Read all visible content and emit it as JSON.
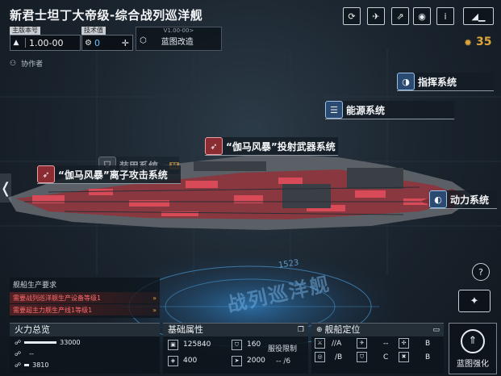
{
  "header": {
    "title": "新君士坦丁大帝级-综合战列巡洋舰",
    "icons": [
      "refresh-icon",
      "share-icon",
      "export-icon",
      "view-icon",
      "info-icon",
      "back-icon"
    ],
    "info_label": "i",
    "currency_value": "35"
  },
  "version_bar": {
    "main_version_label": "主版本号",
    "main_version_value": "1.00-00",
    "tech_label": "技术值",
    "tech_value": "0",
    "version_small": "V1.00-00>",
    "blueprint_mod": "蓝图改造"
  },
  "collaborator": "协作者",
  "systems": {
    "command": "指挥系统",
    "energy": "能源系统",
    "weapon": "“伽马风暴”投射武器系统",
    "armor": "装甲系统",
    "ion": "“伽马风暴”离子攻击系统",
    "power": "动力系统"
  },
  "armor_badge": "M",
  "hull_number": "1523",
  "hull_text": "战列巡洋舰",
  "production": {
    "title": "舰船生产要求",
    "req1": "需要战列巡洋舰生产设备等级1",
    "req2": "需要超主力舰生产线1等级1"
  },
  "firepower": {
    "title": "火力总览",
    "row1": "33000",
    "row2": "--",
    "row3": "3810"
  },
  "base_attrs": {
    "title": "基础属性",
    "hp": "125840",
    "armor": "160",
    "shield": "400",
    "speed": "2000",
    "service_limit_label": "服役限制",
    "service_limit_value": "-- /6"
  },
  "positioning": {
    "title": "舰船定位",
    "cells": [
      {
        "left": "//",
        "right": "A"
      },
      {
        "left": "",
        "right": "--"
      },
      {
        "left": "",
        "right": "B"
      },
      {
        "left": "/",
        "right": "B"
      },
      {
        "left": "",
        "right": "C"
      },
      {
        "left": "",
        "right": "B"
      }
    ]
  },
  "blueprint_enhance": "蓝图强化",
  "help_label": "?",
  "colors": {
    "accent_gold": "#e0a53a",
    "armor_red": "#d84a57",
    "panel": "#0e141b"
  }
}
